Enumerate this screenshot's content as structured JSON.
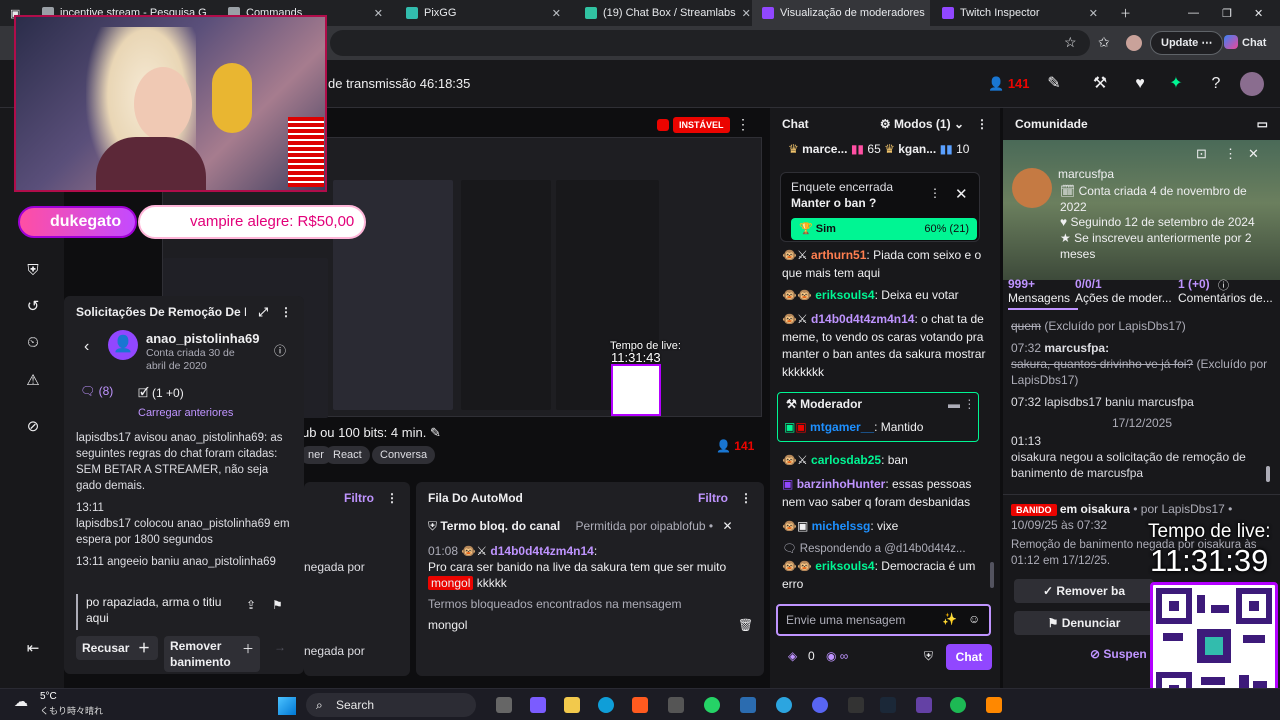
{
  "browser": {
    "tabs": [
      {
        "title": "incentive stream - Pesquisa G",
        "favicon_color": "#9aa0a6"
      },
      {
        "title": "Commands",
        "favicon_color": "#9aa0a6"
      },
      {
        "title": "PixGG",
        "favicon_color": "#32bcad"
      },
      {
        "title": "(19) Chat Box / Streamlabs",
        "favicon_color": "#31c3a2"
      },
      {
        "title": "Visualização de moderadores",
        "favicon_color": "#9147ff"
      },
      {
        "title": "Twitch Inspector",
        "favicon_color": "#9147ff"
      }
    ],
    "update_label": "Update",
    "chat_label": "Chat"
  },
  "topbar": {
    "stream_time": "de transmissão 46:18:35",
    "viewers": "141"
  },
  "video": {
    "unstable_badge": "INSTÁVEL",
    "title_partial": "ub ou 100 bits: 4 min.",
    "tags": [
      "ner",
      "React",
      "Conversa"
    ],
    "viewers": "141",
    "inner_timer_label": "Tempo de live:",
    "inner_timer": "11:31:43"
  },
  "webcam": {
    "alert1": "dukegato",
    "alert2": "vampire alegre: R$50,00"
  },
  "removal": {
    "title": "Solicitações De Remoção De B",
    "user": "anao_pistolinha69",
    "account_created": "Conta criada 30 de abril de 2020",
    "tab_messages": "(8)",
    "tab_actions": "(1 +0)",
    "load_previous": "Carregar anteriores",
    "log1": "lapisdbs17 avisou anao_pistolinha69: as seguintes regras do chat foram citadas: SEM BETAR A STREAMER, não seja gado demais.",
    "log2_time": "13:11",
    "log2": "lapisdbs17 colocou anao_pistolinha69 em espera por 1800 segundos",
    "log3_time": "13:11",
    "log3": "angeeio baniu anao_pistolinha69",
    "request_text": "po rapaziada, arma o titiu aqui",
    "refuse_label": "Recusar",
    "remove_ban_label": "Remover banimento"
  },
  "automod": {
    "filter_label": "Filtro",
    "title": "Fila Do AutoMod",
    "blocked_term": "Termo bloq. do canal",
    "allowed_by": "Permitida por oipablofub •",
    "time": "01:08",
    "user": "d14b0d4t4zm4n14",
    "message_before": "Pro cara ser banido na live da sakura tem que ser muito",
    "highlight": "mongol",
    "message_after": "kkkkk",
    "found_text": "Termos bloqueados encontrados na mensagem",
    "term": "mongol",
    "left_text1": "negada por",
    "left_text2": "negada por"
  },
  "chat": {
    "header": "Chat",
    "modes": "Modos (1)",
    "top_users": [
      {
        "name": "marce...",
        "count": "65"
      },
      {
        "name": "kgan...",
        "count": "10"
      }
    ],
    "poll": {
      "label": "Enquete encerrada",
      "question": "Manter o ban ?",
      "option": "Sim",
      "result": "60% (21)",
      "result_fraction": 0.6
    },
    "messages": [
      {
        "user": "arthurn51",
        "text": ": Piada com seixo e o que mais tem aqui",
        "color": "#ff7f50"
      },
      {
        "user": "eriksouls4",
        "text": ": Deixa eu votar",
        "color": "#00f593"
      },
      {
        "user": "d14b0d4t4zm4n14",
        "text": ": o chat ta de meme, to vendo os caras votando pra manter o ban antes da sakura mostrar kkkkkkk",
        "color": "#bf94ff"
      }
    ],
    "mod_box": {
      "title": "Moderador",
      "user": "mtgamer__",
      "text": ": Mantido"
    },
    "messages2": [
      {
        "user": "carlosdab25",
        "text": ": ban",
        "color": "#00f593"
      },
      {
        "user": "barzinhoHunter",
        "text": ": essas pessoas nem vao saber q foram desbanidas",
        "color": "#bf94ff"
      },
      {
        "user": "michelssg",
        "text": ": vixe",
        "color": "#1e90ff"
      }
    ],
    "replying": "Respondendo a @d14b0d4t4z...",
    "last": {
      "user": "eriksouls4",
      "text": ": Democracia é um erro",
      "color": "#00f593"
    },
    "input_placeholder": "Envie uma mensagem",
    "points": "0",
    "chat_button": "Chat"
  },
  "community": {
    "header": "Comunidade",
    "user": "marcusfpa",
    "created": "Conta criada 4 de novembro de 2022",
    "following": "Seguindo 12 de setembro de 2024",
    "subscribed": "Se inscreveu anteriormente por 2 meses",
    "stats": [
      {
        "n": "999+",
        "l": "Mensagens"
      },
      {
        "n": "0/0/1",
        "l": "Ações de moder..."
      },
      {
        "n": "1 (+0)",
        "l": "Comentários de..."
      }
    ],
    "log_top": "quem",
    "log_top_suffix": "(Excluído por LapisDbs17)",
    "log1_time": "07:32",
    "log1_user": "marcusfpa:",
    "log1_strike": "sakura, quantos drivinho ve já foi?",
    "log1_suffix": "(Excluído por LapisDbs17)",
    "log2": "07:32 lapisdbs17 baniu marcusfpa",
    "date_sep": "17/12/2025",
    "log3_time": "01:13",
    "log3": "oisakura negou a solicitação de remoção de banimento de marcusfpa",
    "banido_badge": "BANIDO",
    "ban_in": "em oisakura",
    "ban_by": "• por LapisDbs17 •",
    "ban_date": "10/09/25 às 07:32",
    "ban_note": "Remoção de banimento negada por oisakura às 01:12 em 17/12/25.",
    "remove_ban": "Remover ba",
    "report": "Denunciar",
    "suspend": "Suspen"
  },
  "overlay": {
    "live_label": "Tempo de live:",
    "live_time": "11:31:39"
  },
  "taskbar": {
    "weather": "5°C",
    "weather_desc": "くもり時々晴れ",
    "search": "Search"
  }
}
